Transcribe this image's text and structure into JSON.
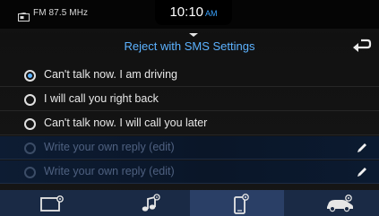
{
  "status_bar": {
    "radio_icon": "radio-tuner-icon",
    "radio_text": "FM 87.5 MHz",
    "time": "10:10",
    "ampm": "AM"
  },
  "header": {
    "title": "Reject with SMS Settings",
    "back_icon": "back-arrow-icon"
  },
  "replies": [
    {
      "label": "Can't talk now. I am driving",
      "selected": true,
      "enabled": true
    },
    {
      "label": "I will call you right back",
      "selected": false,
      "enabled": true
    },
    {
      "label": "Can't talk now. I will call you later",
      "selected": false,
      "enabled": true
    },
    {
      "label": "Write your own reply (edit)",
      "selected": false,
      "enabled": false,
      "icon": "pencil-icon"
    },
    {
      "label": "Write your own reply (edit)",
      "selected": false,
      "enabled": false,
      "icon": "pencil-icon"
    }
  ],
  "nav": {
    "tabs": [
      {
        "icon": "screen-settings-icon",
        "active": false
      },
      {
        "icon": "music-settings-icon",
        "active": false
      },
      {
        "icon": "phone-settings-icon",
        "active": true
      },
      {
        "icon": "vehicle-settings-icon",
        "active": false
      }
    ]
  },
  "colors": {
    "accent": "#5cb2ff",
    "disabled_row": "#0d1c33",
    "nav_bar": "#1a2a45",
    "nav_active": "#2a3f66"
  }
}
